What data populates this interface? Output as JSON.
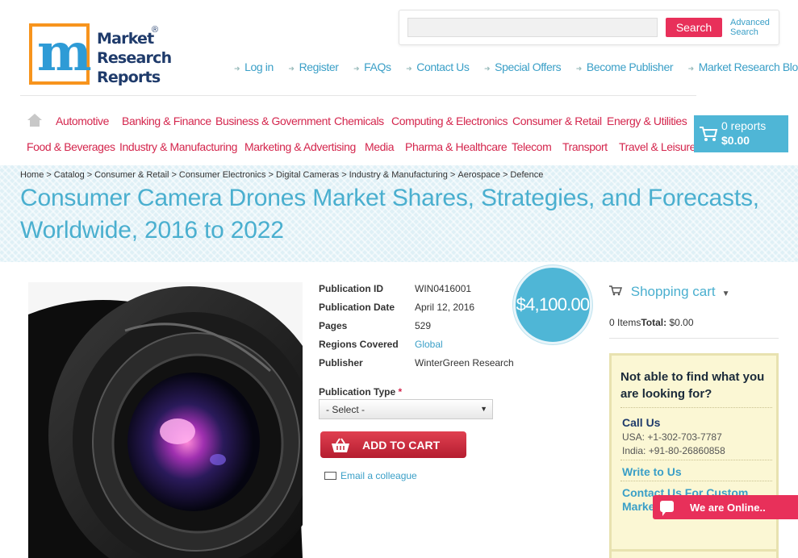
{
  "logo": {
    "mark": "m",
    "line1": "Market",
    "line2": "Research",
    "line3": "Reports",
    "reg": "®"
  },
  "search": {
    "placeholder": "",
    "button": "Search",
    "advanced_line1": "Advanced",
    "advanced_line2": "Search"
  },
  "toplinks": [
    "Log in",
    "Register",
    "FAQs",
    "Contact Us",
    "Special Offers",
    "Become Publisher",
    "Market Research Blog"
  ],
  "categories_row1": [
    "Automotive",
    "Banking & Finance",
    "Business & Government",
    "Chemicals",
    "Computing & Electronics",
    "Consumer & Retail",
    "Energy & Utilities"
  ],
  "categories_row2": [
    "Food & Beverages",
    "Industry & Manufacturing",
    "Marketing & Advertising",
    "Media",
    "Pharma & Healthcare",
    "Telecom",
    "Transport",
    "Travel & Leisure"
  ],
  "cart": {
    "reports": "0 reports",
    "total": "$0.00"
  },
  "breadcrumb": [
    "Home",
    "Catalog",
    "Consumer & Retail",
    "Consumer Electronics",
    "Digital Cameras",
    "Industry & Manufacturing",
    "Aerospace",
    "Defence"
  ],
  "title": "Consumer Camera Drones Market Shares, Strategies, and Forecasts, Worldwide, 2016 to 2022",
  "details": {
    "pub_id_label": "Publication ID",
    "pub_id": "WIN0416001",
    "pub_date_label": "Publication Date",
    "pub_date": "April 12, 2016",
    "pages_label": "Pages",
    "pages": "529",
    "regions_label": "Regions Covered",
    "regions": "Global",
    "publisher_label": "Publisher",
    "publisher": "WinterGreen Research"
  },
  "price": "$4,100.00",
  "pub_type": {
    "label": "Publication Type",
    "required": "*",
    "selected": "- Select -"
  },
  "add_to_cart": "ADD TO CART",
  "email_colleague": "Email a colleague",
  "shopping_cart": {
    "title": "Shopping cart",
    "items": "0 Items",
    "total_label": "Total:",
    "total": "$0.00"
  },
  "help": {
    "question": "Not able to find what you are looking for?",
    "call_us": "Call Us",
    "usa": "USA: +1-302-703-7787",
    "india": "India: +91-80-26860858",
    "write": "Write to Us",
    "contact": "Contact Us For Custom Market"
  },
  "chat": "We are Online..",
  "colors": {
    "accent_pink": "#e8305a",
    "accent_blue": "#4fb6d6",
    "link_blue": "#3a9fc7",
    "nav_red": "#d4264d"
  }
}
